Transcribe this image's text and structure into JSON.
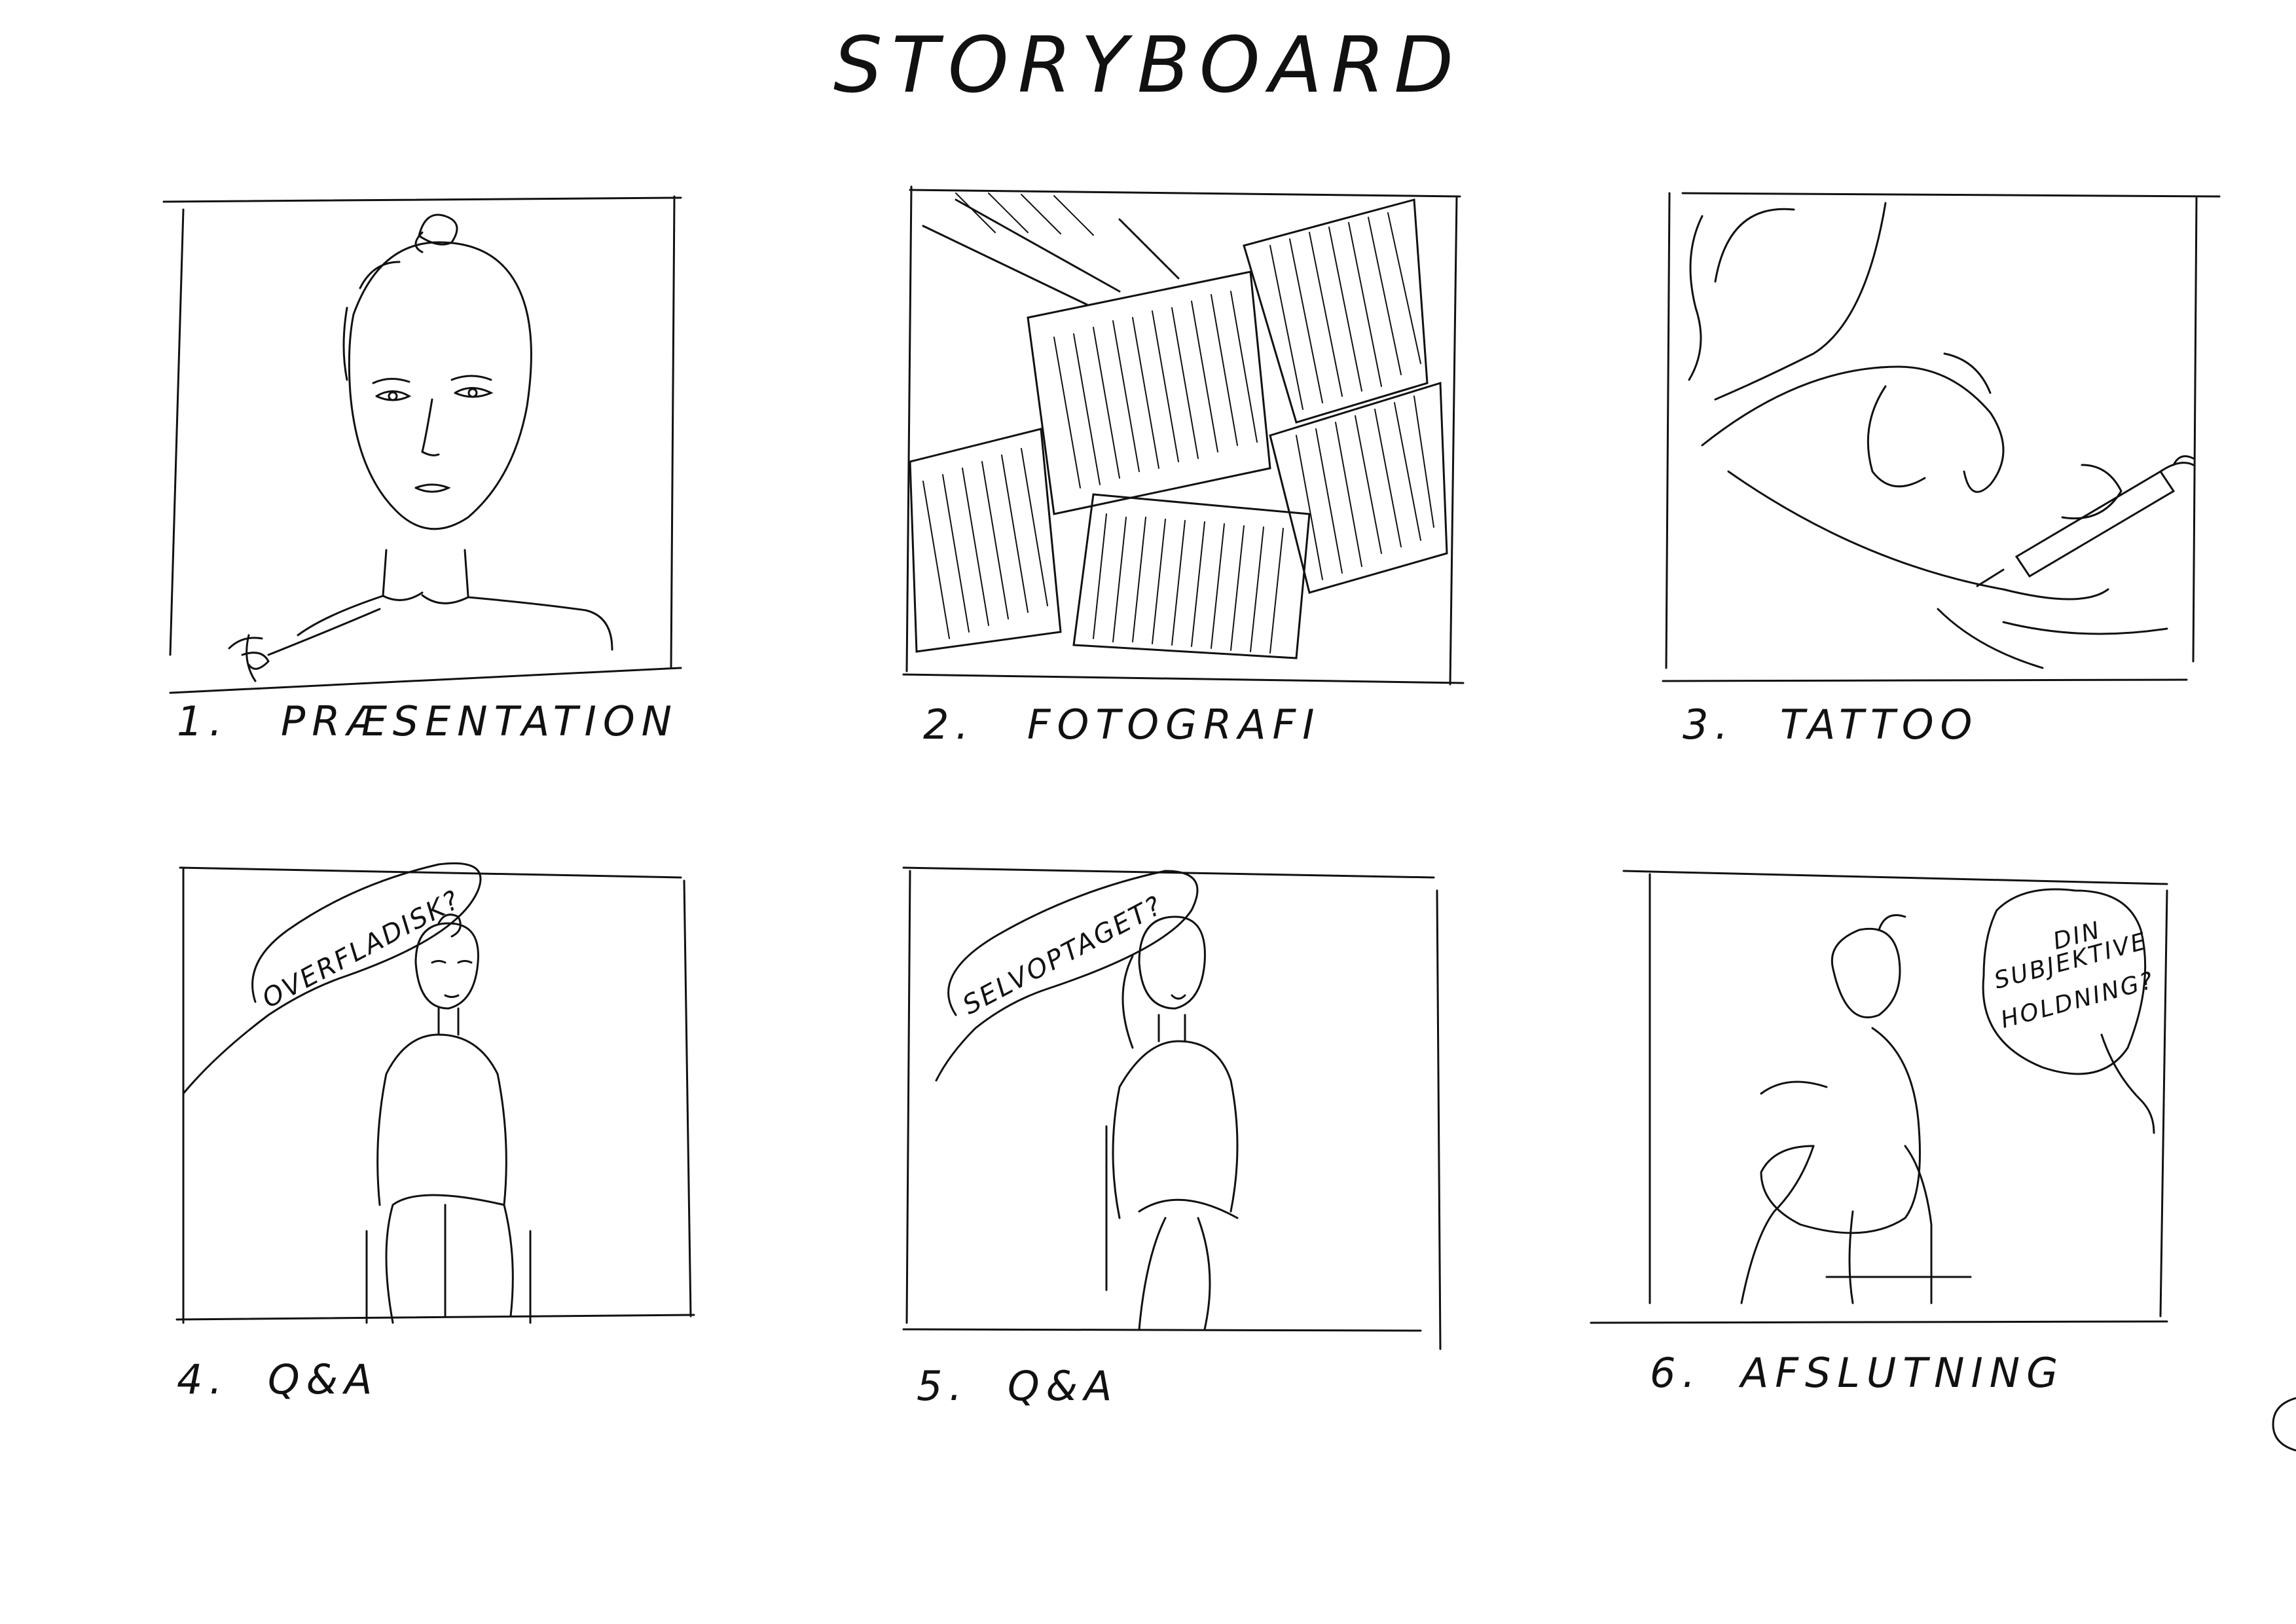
{
  "title": "STORYBOARD",
  "panels": [
    {
      "number": "1.",
      "caption": "PRÆSENTATION",
      "speech": ""
    },
    {
      "number": "2.",
      "caption": "FOTOGRAFI",
      "speech": ""
    },
    {
      "number": "3.",
      "caption": "TATTOO",
      "speech": ""
    },
    {
      "number": "4.",
      "caption": "Q&A",
      "speech": "OVERFLADISK?"
    },
    {
      "number": "5.",
      "caption": "Q&A",
      "speech": "SELVOPTAGET?"
    },
    {
      "number": "6.",
      "caption": "AFSLUTNING",
      "speech_lines": [
        "DIN",
        "SUBJEKTIVE",
        "HOLDNING?"
      ]
    }
  ]
}
